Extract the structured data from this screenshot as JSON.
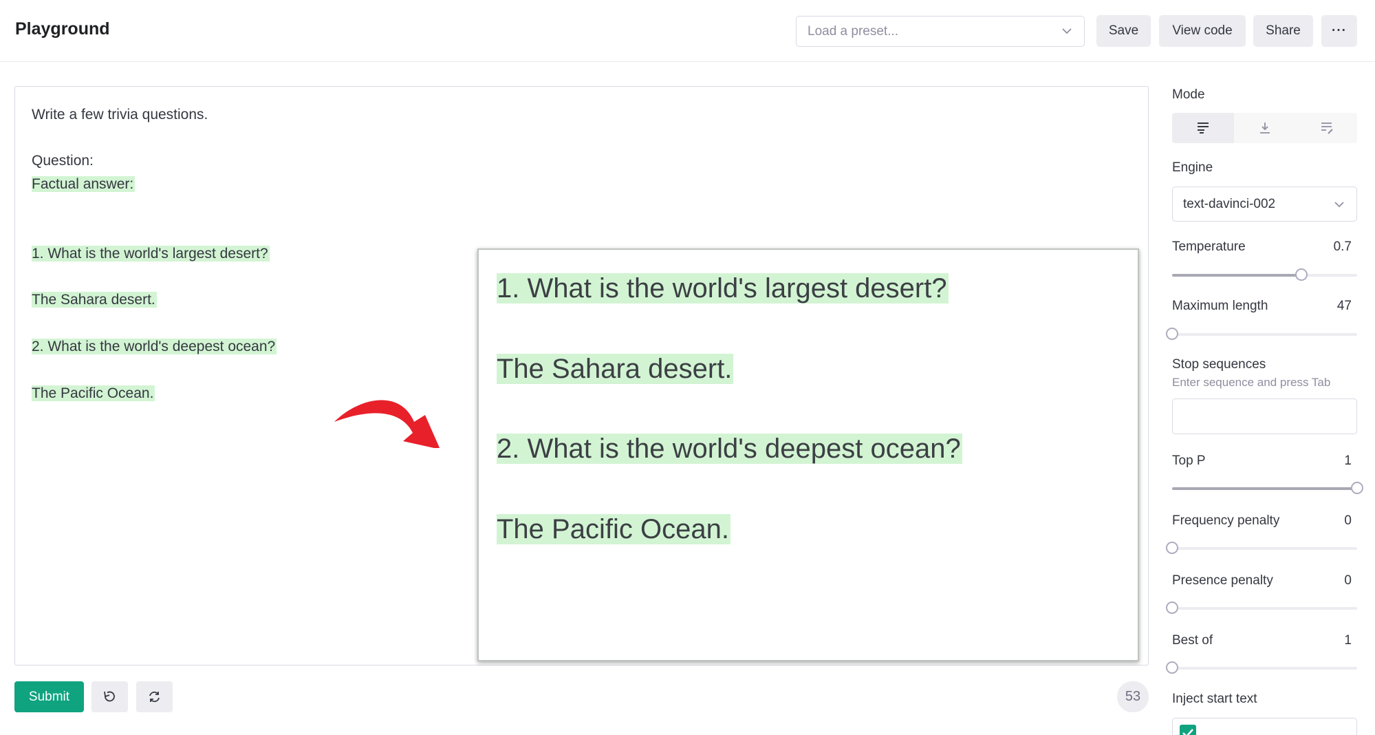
{
  "header": {
    "title": "Playground",
    "preset_placeholder": "Load a preset...",
    "save_label": "Save",
    "view_code_label": "View code",
    "share_label": "Share",
    "more_label": "···"
  },
  "editor": {
    "lines": [
      "Write a few trivia questions.",
      "Question:",
      "Factual answer:",
      "1. What is the world's largest desert?",
      "The Sahara desert.",
      "2. What is the world's deepest ocean?",
      "The Pacific Ocean."
    ],
    "zoom_lines": [
      "1. What is the world's largest desert?",
      "The Sahara desert.",
      "2. What is the world's deepest ocean?",
      "The Pacific Ocean."
    ],
    "highlight_color": "#d2f4d3",
    "arrow_color": "#e8202a"
  },
  "footer": {
    "submit_label": "Submit",
    "token_count": "53"
  },
  "sidebar": {
    "mode_label": "Mode",
    "mode_icons": [
      "complete-mode-icon",
      "insert-mode-icon",
      "edit-mode-icon"
    ],
    "engine_label": "Engine",
    "engine_value": "text-davinci-002",
    "temperature_label": "Temperature",
    "temperature_value": "0.7",
    "temperature_fraction": 0.7,
    "max_length_label": "Maximum length",
    "max_length_value": "47",
    "max_length_fraction": 0.0,
    "stop_label": "Stop sequences",
    "stop_hint": "Enter sequence and press Tab",
    "top_p_label": "Top P",
    "top_p_value": "1",
    "top_p_fraction": 1.0,
    "freq_label": "Frequency penalty",
    "freq_value": "0",
    "freq_fraction": 0.0,
    "presence_label": "Presence penalty",
    "presence_value": "0",
    "presence_fraction": 0.0,
    "best_of_label": "Best of",
    "best_of_value": "1",
    "best_of_fraction": 0.0,
    "inject_label": "Inject start text",
    "inject_checked": true,
    "accent_color": "#10a37f"
  }
}
